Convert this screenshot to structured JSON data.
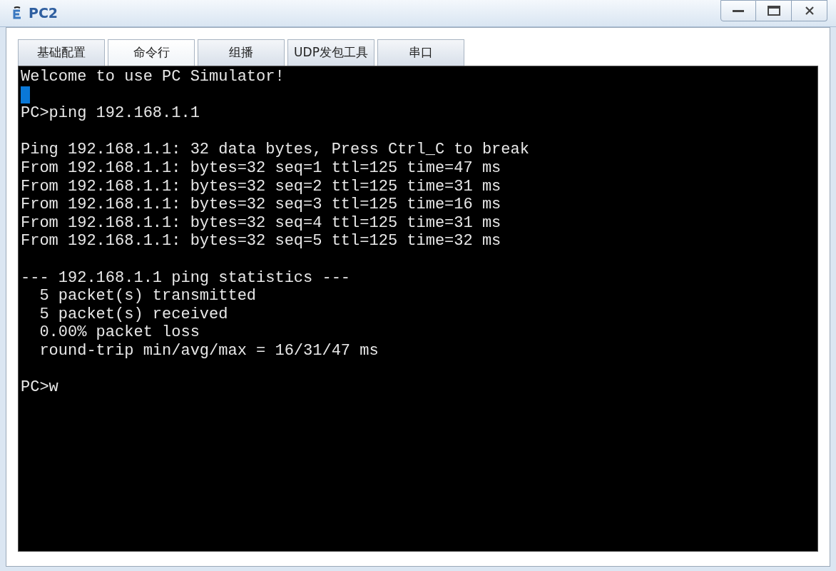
{
  "window": {
    "title": "PC2"
  },
  "tabs": [
    {
      "label": "基础配置",
      "selected": false
    },
    {
      "label": "命令行",
      "selected": true
    },
    {
      "label": "组播",
      "selected": false
    },
    {
      "label": "UDP发包工具",
      "selected": false
    },
    {
      "label": "串口",
      "selected": false
    }
  ],
  "terminal": {
    "lines": [
      {
        "kind": "text",
        "text": "Welcome to use PC Simulator!"
      },
      {
        "kind": "cursor"
      },
      {
        "kind": "text",
        "text": "PC>ping 192.168.1.1"
      },
      {
        "kind": "blank"
      },
      {
        "kind": "text",
        "text": "Ping 192.168.1.1: 32 data bytes, Press Ctrl_C to break"
      },
      {
        "kind": "text",
        "text": "From 192.168.1.1: bytes=32 seq=1 ttl=125 time=47 ms"
      },
      {
        "kind": "text",
        "text": "From 192.168.1.1: bytes=32 seq=2 ttl=125 time=31 ms"
      },
      {
        "kind": "text",
        "text": "From 192.168.1.1: bytes=32 seq=3 ttl=125 time=16 ms"
      },
      {
        "kind": "text",
        "text": "From 192.168.1.1: bytes=32 seq=4 ttl=125 time=31 ms"
      },
      {
        "kind": "text",
        "text": "From 192.168.1.1: bytes=32 seq=5 ttl=125 time=32 ms"
      },
      {
        "kind": "blank"
      },
      {
        "kind": "text",
        "text": "--- 192.168.1.1 ping statistics ---"
      },
      {
        "kind": "text",
        "text": "  5 packet(s) transmitted"
      },
      {
        "kind": "text",
        "text": "  5 packet(s) received"
      },
      {
        "kind": "text",
        "text": "  0.00% packet loss"
      },
      {
        "kind": "text",
        "text": "  round-trip min/avg/max = 16/31/47 ms"
      },
      {
        "kind": "blank"
      },
      {
        "kind": "text",
        "text": "PC>w"
      }
    ]
  }
}
